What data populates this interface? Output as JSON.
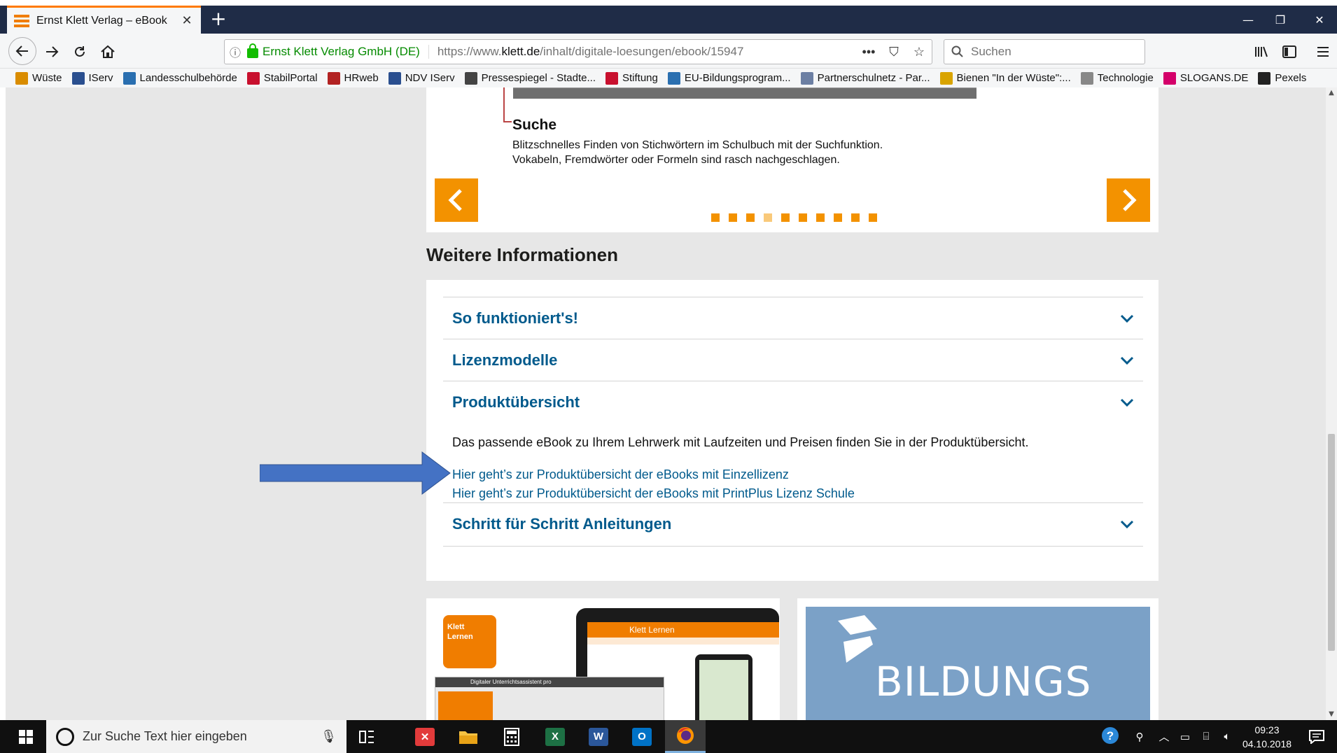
{
  "browser": {
    "tab_title": "Ernst Klett Verlag – eBook",
    "tab_close": "✕",
    "new_tab": "+",
    "window_controls": {
      "minimize": "—",
      "restore": "❐",
      "close": "✕"
    },
    "url": {
      "org_label": "Ernst Klett Verlag GmbH (DE)",
      "prefix": "https://www.",
      "domain": "klett.de",
      "path": "/inhalt/digitale-loesungen/ebook/15947"
    },
    "url_actions": {
      "more": "•••",
      "pocket": "⛉",
      "bookmark": "☆"
    },
    "search_placeholder": "Suchen",
    "bookmarks": [
      {
        "label": "Wüste",
        "icon": "wueste-icon",
        "color": "#d98c00"
      },
      {
        "label": "IServ",
        "icon": "iserv-icon",
        "color": "#2a4f8f"
      },
      {
        "label": "Landesschulbehörde",
        "icon": "landesschulbehoerde-icon",
        "color": "#2a6fb0"
      },
      {
        "label": "StabilPortal",
        "icon": "stabilportal-icon",
        "color": "#c8102e"
      },
      {
        "label": "HRweb",
        "icon": "hrweb-icon",
        "color": "#b22222"
      },
      {
        "label": "NDV IServ",
        "icon": "iserv-icon",
        "color": "#2a4f8f"
      },
      {
        "label": "Pressespiegel - Stadte...",
        "icon": "pressespiegel-icon",
        "color": "#444444"
      },
      {
        "label": "Stiftung",
        "icon": "stiftung-icon",
        "color": "#c8102e"
      },
      {
        "label": "EU-Bildungsprogram...",
        "icon": "eu-icon",
        "color": "#2a6fb0"
      },
      {
        "label": "Partnerschulnetz - Par...",
        "icon": "partnerschulnetz-icon",
        "color": "#6c7fa3"
      },
      {
        "label": "Bienen \"In der Wüste\":...",
        "icon": "bienen-icon",
        "color": "#d9a400"
      },
      {
        "label": "Technologie",
        "icon": "technologie-icon",
        "color": "#888888"
      },
      {
        "label": "SLOGANS.DE",
        "icon": "slogans-icon",
        "color": "#d4006a"
      },
      {
        "label": "Pexels",
        "icon": "pexels-icon",
        "color": "#222222"
      }
    ]
  },
  "slider": {
    "title": "Suche",
    "text_line1": "Blitzschnelles Finden von Stichwörtern im Schulbuch mit der Suchfunktion.",
    "text_line2": "Vokabeln, Fremdwörter oder Formeln sind rasch nachgeschlagen.",
    "dots_total": 10,
    "active_dot": 3,
    "accent_color": "#f39200"
  },
  "section_title": "Weitere Informationen",
  "accordion": {
    "items": [
      {
        "label": "So funktioniert's!",
        "expanded": false
      },
      {
        "label": "Lizenzmodelle",
        "expanded": false
      },
      {
        "label": "Produktübersicht",
        "expanded": true
      },
      {
        "label": "Schritt für Schritt Anleitungen",
        "expanded": false
      }
    ],
    "produkt_description": "Das passende eBook zu Ihrem Lehrwerk mit Laufzeiten und Preisen finden Sie in der Produktübersicht.",
    "link_einzellizenz": "Hier geht’s zur Produktübersicht der eBooks mit Einzellizenz",
    "link_printplus": "Hier geht’s zur Produktübersicht der eBooks mit PrintPlus Lizenz Schule",
    "link_color": "#005a8c"
  },
  "teasers": {
    "klett_tile_line1": "Klett",
    "klett_tile_line2": "Lernen",
    "tablet_header": "Klett Lernen",
    "laptop_header": "Digitaler Unterrichtsassistent pro",
    "bildungs_text": "BILDUNGS"
  },
  "taskbar": {
    "search_placeholder": "Zur Suche Text hier eingeben",
    "apps": [
      {
        "name": "task-view",
        "label": ""
      },
      {
        "name": "xmind",
        "label": ""
      },
      {
        "name": "explorer",
        "label": ""
      },
      {
        "name": "calculator",
        "label": ""
      },
      {
        "name": "excel",
        "label": "X"
      },
      {
        "name": "word",
        "label": "W"
      },
      {
        "name": "outlook",
        "label": "O"
      },
      {
        "name": "firefox",
        "label": ""
      }
    ],
    "time": "09:23",
    "date": "04.10.2018"
  }
}
